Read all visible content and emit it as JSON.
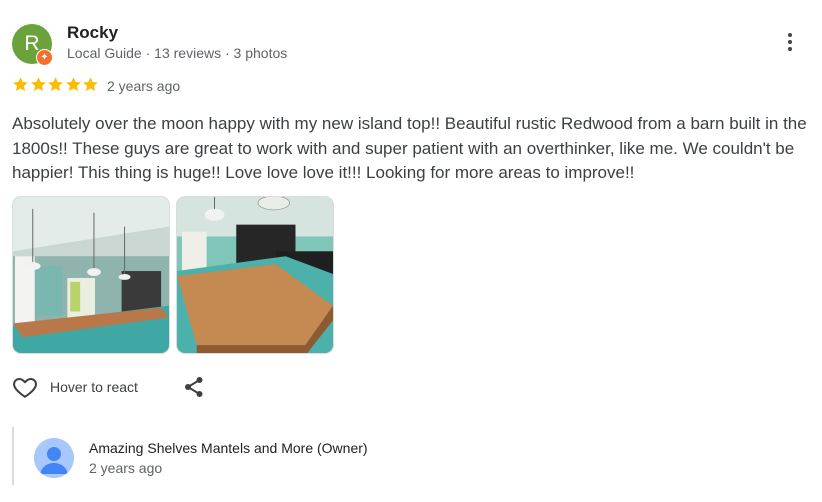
{
  "review": {
    "author": {
      "initial": "R",
      "name": "Rocky",
      "meta": [
        "Local Guide",
        "13 reviews",
        "3 photos"
      ],
      "separator": " · "
    },
    "rating": 5,
    "rating_max": 5,
    "time": "2 years ago",
    "text": "Absolutely over the moon happy with my new island top!! Beautiful rustic Redwood from a barn built in the 1800s!! These guys are great to work with and super patient with an overthinker, like me. We couldn't be happier! This thing is huge!! Love love love it!!! Looking for more areas to improve!!",
    "photos": [
      {
        "icon": "kitchen-island-photo-1"
      },
      {
        "icon": "kitchen-island-photo-2"
      }
    ],
    "actions": {
      "react_label": "Hover to react",
      "react_icon": "heart-outline-icon",
      "share_icon": "share-icon"
    },
    "more_icon": "three-dot-vertical-icon"
  },
  "owner_reply": {
    "name": "Amazing Shelves Mantels and More (Owner)",
    "time": "2 years ago",
    "avatar_icon": "default-person-avatar"
  },
  "colors": {
    "star": "#fbbc04",
    "avatar_bg": "#6ba23c",
    "guide_badge": "#f46f2e",
    "secondary_text": "#5f6368",
    "owner_avatar_bg": "#a8c7fa"
  }
}
